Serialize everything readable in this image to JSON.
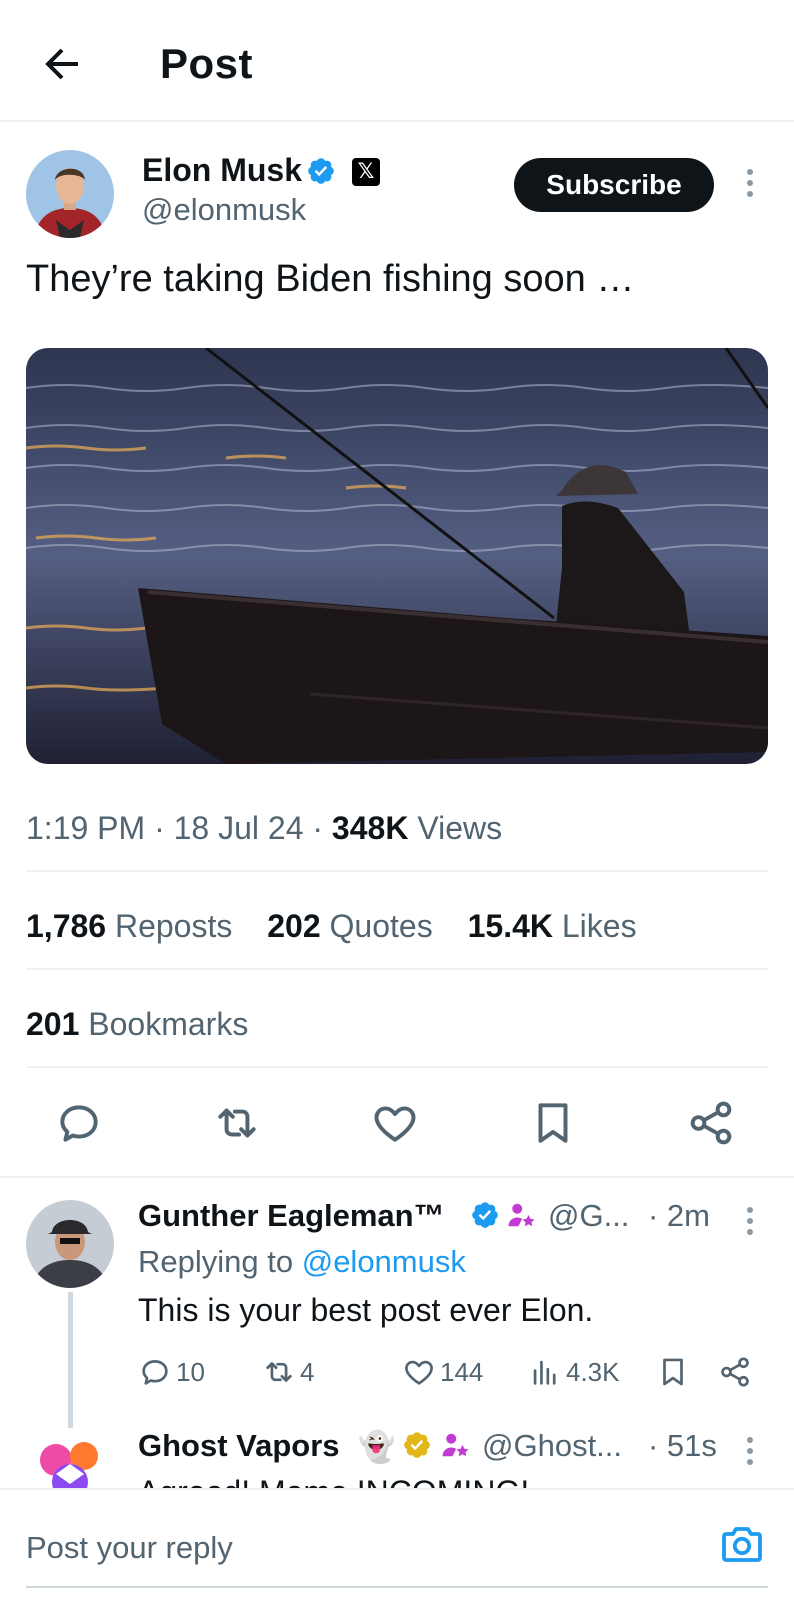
{
  "header": {
    "title": "Post",
    "back_icon": "arrow-left-icon"
  },
  "post": {
    "author_name": "Elon Musk",
    "author_handle": "@elonmusk",
    "subscribe_label": "Subscribe",
    "text": "They’re taking Biden fishing soon …",
    "time": "1:19 PM",
    "date": "18 Jul 24",
    "views_count": "348K",
    "views_label": "Views",
    "stats": {
      "reposts_count": "1,786",
      "reposts_label": "Reposts",
      "quotes_count": "202",
      "quotes_label": "Quotes",
      "likes_count": "15.4K",
      "likes_label": "Likes",
      "bookmarks_count": "201",
      "bookmarks_label": "Bookmarks"
    },
    "actions": [
      "reply-icon",
      "repost-icon",
      "like-icon",
      "bookmark-icon",
      "share-icon"
    ]
  },
  "replies": [
    {
      "name": "Gunther Eagleman™",
      "handle": "@G...",
      "time": "· 2m",
      "replying_prefix": "Replying to ",
      "replying_handle": "@elonmusk",
      "text": "This is your best post ever Elon.",
      "reply_count": "10",
      "repost_count": "4",
      "like_count": "144",
      "view_count": "4.3K"
    },
    {
      "name": "Ghost Vapors",
      "handle": "@Ghost...",
      "time": "· 51s",
      "text": "Agreed! Meme INCOMING!"
    }
  ],
  "compose": {
    "placeholder": "Post your reply",
    "camera_icon": "camera-icon"
  },
  "colors": {
    "accent": "#1d9bf0",
    "text": "#0f1419",
    "muted": "#536471",
    "gold": "#e2b719",
    "purple": "#c23bd4"
  }
}
